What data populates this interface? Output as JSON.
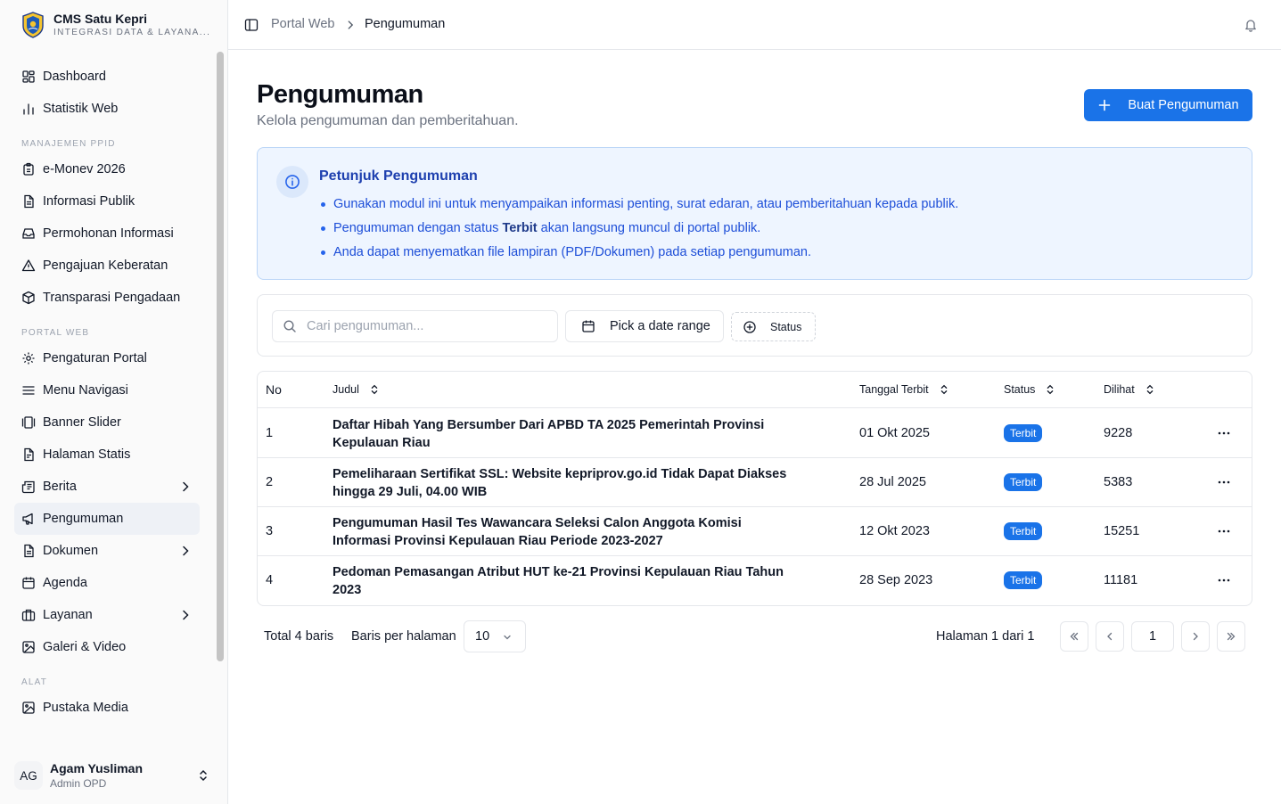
{
  "brand": {
    "title": "CMS Satu Kepri",
    "subtitle": "INTEGRASI DATA & LAYANA..."
  },
  "sidebar": {
    "items_top": [
      {
        "label": "Dashboard",
        "icon": "dashboard-icon"
      },
      {
        "label": "Statistik Web",
        "icon": "bar-chart-icon"
      }
    ],
    "section_ppid": "MANAJEMEN PPID",
    "items_ppid": [
      {
        "label": "e-Monev 2026",
        "icon": "clipboard-icon"
      },
      {
        "label": "Informasi Publik",
        "icon": "file-text-icon"
      },
      {
        "label": "Permohonan Informasi",
        "icon": "inbox-icon"
      },
      {
        "label": "Pengajuan Keberatan",
        "icon": "alert-triangle-icon"
      },
      {
        "label": "Transparasi Pengadaan",
        "icon": "package-icon"
      }
    ],
    "section_portal": "PORTAL WEB",
    "items_portal": [
      {
        "label": "Pengaturan Portal",
        "icon": "gear-icon"
      },
      {
        "label": "Menu Navigasi",
        "icon": "menu-icon"
      },
      {
        "label": "Banner Slider",
        "icon": "gallery-icon"
      },
      {
        "label": "Halaman Statis",
        "icon": "file-icon"
      },
      {
        "label": "Berita",
        "icon": "newspaper-icon"
      },
      {
        "label": "Pengumuman",
        "icon": "megaphone-icon"
      },
      {
        "label": "Dokumen",
        "icon": "document-icon"
      },
      {
        "label": "Agenda",
        "icon": "calendar-icon"
      },
      {
        "label": "Layanan",
        "icon": "briefcase-icon"
      },
      {
        "label": "Galeri & Video",
        "icon": "image-icon"
      }
    ],
    "section_alat": "ALAT",
    "items_alat": [
      {
        "label": "Pustaka Media",
        "icon": "image-icon"
      }
    ],
    "active": "Pengumuman"
  },
  "user": {
    "initials": "AG",
    "name": "Agam Yusliman",
    "role": "Admin OPD"
  },
  "breadcrumb": {
    "parent": "Portal Web",
    "current": "Pengumuman"
  },
  "page": {
    "title": "Pengumuman",
    "subtitle": "Kelola pengumuman dan pemberitahuan.",
    "create_button": "Buat Pengumuman"
  },
  "info": {
    "title": "Petunjuk Pengumuman",
    "line1": "Gunakan modul ini untuk menyampaikan informasi penting, surat edaran, atau pemberitahuan kepada publik.",
    "line2_before": "Pengumuman dengan status ",
    "line2_bold": "Terbit",
    "line2_after": " akan langsung muncul di portal publik.",
    "line3": "Anda dapat menyematkan file lampiran (PDF/Dokumen) pada setiap pengumuman."
  },
  "filters": {
    "search_placeholder": "Cari pengumuman...",
    "date_range": "Pick a date range",
    "status": "Status"
  },
  "table": {
    "columns": {
      "no": "No",
      "judul": "Judul",
      "tanggal": "Tanggal Terbit",
      "status": "Status",
      "dilihat": "Dilihat"
    },
    "rows": [
      {
        "no": "1",
        "judul": "Daftar Hibah Yang Bersumber Dari APBD TA 2025 Pemerintah Provinsi Kepulauan Riau",
        "tanggal": "01 Okt 2025",
        "status": "Terbit",
        "dilihat": "9228"
      },
      {
        "no": "2",
        "judul": "Pemeliharaan Sertifikat SSL: Website kepriprov.go.id Tidak Dapat Diakses hingga 29 Juli, 04.00 WIB",
        "tanggal": "28 Jul 2025",
        "status": "Terbit",
        "dilihat": "5383"
      },
      {
        "no": "3",
        "judul": "Pengumuman Hasil Tes Wawancara Seleksi Calon Anggota Komisi Informasi Provinsi Kepulauan Riau Periode 2023-2027",
        "tanggal": "12 Okt 2023",
        "status": "Terbit",
        "dilihat": "15251"
      },
      {
        "no": "4",
        "judul": "Pedoman Pemasangan Atribut HUT ke-21 Provinsi Kepulauan Riau Tahun 2023",
        "tanggal": "28 Sep 2023",
        "status": "Terbit",
        "dilihat": "11181"
      }
    ]
  },
  "pagination": {
    "total": "Total 4 baris",
    "rows_per_page_label": "Baris per halaman",
    "rows_per_page": "10",
    "page_info": "Halaman 1 dari 1",
    "current_page": "1"
  },
  "colors": {
    "accent": "#1a73e8",
    "info_bg": "#eef5ff",
    "info_text": "#1d4ed8"
  }
}
